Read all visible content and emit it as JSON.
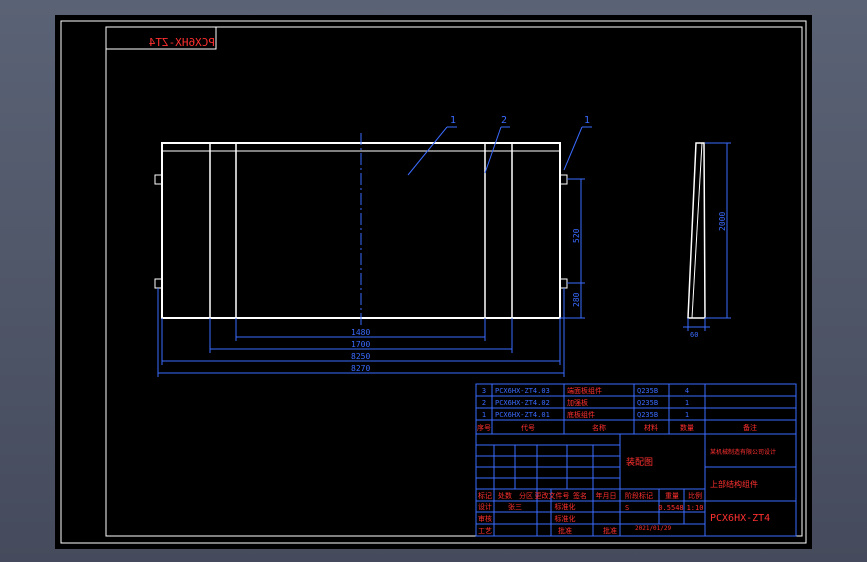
{
  "drawing": {
    "code_stamp": "PCX6HX-ZT4",
    "views": {
      "front": {
        "balloons": [
          "1",
          "2",
          "1"
        ],
        "dimensions_horizontal": [
          "1480",
          "1700",
          "8250",
          "8270"
        ],
        "dimensions_vertical": [
          "520",
          "280"
        ]
      },
      "side": {
        "dimensions": [
          "2000",
          "60"
        ]
      }
    },
    "bom": {
      "rows": [
        {
          "seq": "3",
          "code": "PCX6HX-ZT4.03",
          "name": "端面板组件",
          "material": "Q235B",
          "qty": "4",
          "note": ""
        },
        {
          "seq": "2",
          "code": "PCX6HX-ZT4.02",
          "name": "加强板",
          "material": "Q235B",
          "qty": "1",
          "note": ""
        },
        {
          "seq": "1",
          "code": "PCX6HX-ZT4.01",
          "name": "底板组件",
          "material": "Q235B",
          "qty": "1",
          "note": ""
        }
      ],
      "headers": [
        "序号",
        "代号",
        "名称",
        "材料",
        "数量",
        "备注"
      ]
    },
    "title_block": {
      "material_note": "装配图",
      "company": "某机械制造有限公司设计",
      "part_name": "上部结构组件",
      "drawing_code": "PCX6HX-ZT4",
      "stage": "S",
      "weight": "0.5548",
      "scale": "1:10",
      "date": "2021/01/29",
      "labels": {
        "marking": "标记",
        "count": "处数",
        "zone": "分区",
        "change_doc": "更改文件号",
        "signature": "签名",
        "ymd": "年月日",
        "design": "设计",
        "standardize": "标准化",
        "check": "审核",
        "process": "工艺",
        "approve": "批准",
        "stage_mark": "阶段标记",
        "weight_label": "重量",
        "scale_label": "比例"
      },
      "designer": "张三",
      "standard_sig": "标准化",
      "approve_sig": "批准"
    }
  }
}
